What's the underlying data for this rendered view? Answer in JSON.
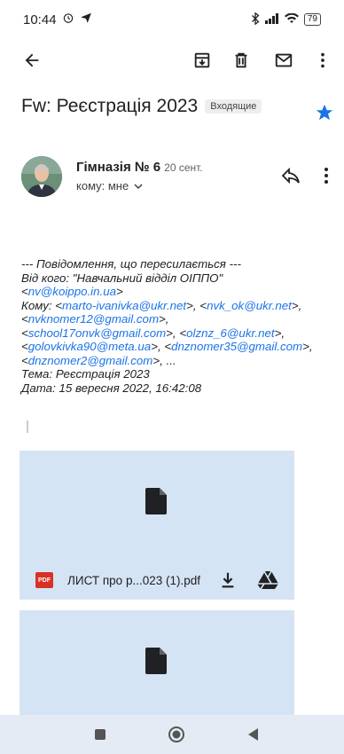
{
  "status": {
    "time": "10:44",
    "battery": "79"
  },
  "toolbar": {
    "back": "back-arrow-icon",
    "archive": "archive-icon",
    "delete": "trash-icon",
    "mail": "mail-icon",
    "more": "more-vert-icon"
  },
  "email": {
    "subject": "Fw: Реєстрація 2023",
    "label": "Входящие",
    "starred": true,
    "sender": "Гімназія № 6",
    "date": "20 сент.",
    "recipient": "кому: мне",
    "body": {
      "header": "--- Повідомлення, що пересилається ---",
      "from_label": "Від кого: ",
      "from_name": "\"Навчальний відділ ОІППО\"",
      "from_email": "nv@koippo.in.ua",
      "to_label": "Кому: ",
      "to_emails": [
        "marto-ivanivka@ukr.net",
        "nvk_ok@ukr.net",
        "nvknomer12@gmail.com",
        "school17onvk@gmail.com",
        "olznz_6@ukr.net",
        "golovkivka90@meta.ua",
        "dnznomer35@gmail.com",
        "dnznomer2@gmail.com"
      ],
      "ellipsis": "...",
      "subject_line": "Тема: Реєстрація 2023",
      "date_line": "Дата: 15 вересня 2022, 16:42:08"
    },
    "attachments": [
      {
        "badge": "PDF",
        "filename": "ЛИСТ про р...023 (1).pdf"
      },
      {
        "badge": "",
        "filename": ""
      }
    ]
  },
  "colors": {
    "link": "#1a73e8",
    "star": "#1a73e8",
    "attachment_bg": "#d5e4f5",
    "pdf_red": "#d93025"
  }
}
